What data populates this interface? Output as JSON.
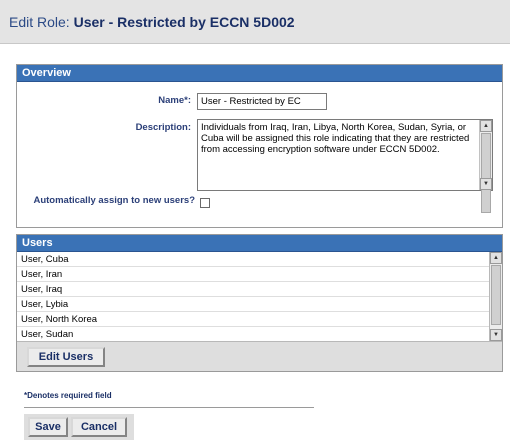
{
  "header": {
    "title_prefix": "Edit Role:",
    "role_name": "User - Restricted by ECCN 5D002"
  },
  "overview": {
    "section_title": "Overview",
    "name_label": "Name*:",
    "name_value": "User - Restricted by EC",
    "description_label": "Description:",
    "description_value": "Individuals from Iraq, Iran, Libya, North Korea, Sudan, Syria, or Cuba  will be assigned this role indicating that they are restricted from accessing encryption software under ECCN 5D002.",
    "auto_assign_label": "Automatically assign to new users?",
    "auto_assign_checked": false
  },
  "users": {
    "section_title": "Users",
    "items": [
      "User, Cuba",
      "User, Iran",
      "User, Iraq",
      "User, Lybia",
      "User, North Korea",
      "User, Sudan"
    ],
    "edit_button": "Edit Users"
  },
  "footer": {
    "required_note": "*Denotes required field",
    "save_button": "Save",
    "cancel_button": "Cancel"
  },
  "colors": {
    "section_header_bg": "#3a72b6",
    "label_text": "#2b3f78",
    "title_text": "#1a2f66",
    "page_header_bg": "#e4e4e4"
  },
  "icons": {
    "scroll_up": "scroll-up-arrow-icon",
    "scroll_down": "scroll-down-arrow-icon"
  }
}
